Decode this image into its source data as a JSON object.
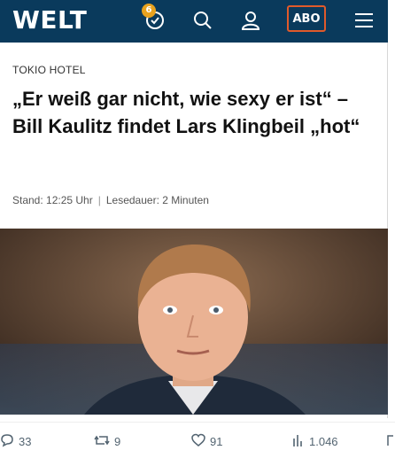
{
  "header": {
    "logo": "WELT",
    "notification_count": "6",
    "abo_label": "ABO"
  },
  "article": {
    "kicker": "TOKIO HOTEL",
    "headline": "„Er weiß gar nicht, wie sexy er ist“ – Bill Kaulitz findet Lars Klingbeil „hot“",
    "stand": "Stand: 12:25 Uhr",
    "lesedauer": "Lesedauer: 2 Minuten"
  },
  "stats": {
    "replies": "33",
    "reposts": "9",
    "likes": "91",
    "views": "1.046"
  },
  "colors": {
    "header_bg": "#0a3a5c",
    "badge": "#e8a21e",
    "abo_border": "#e05a2b"
  },
  "icons": [
    "clock-icon",
    "search-icon",
    "user-icon",
    "menu-icon",
    "reply-icon",
    "repost-icon",
    "like-icon",
    "views-icon",
    "share-icon"
  ]
}
